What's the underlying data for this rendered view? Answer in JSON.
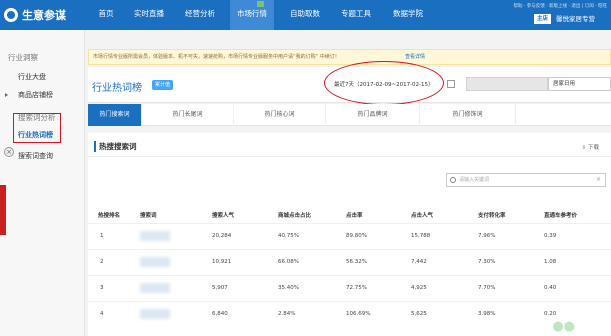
{
  "app": {
    "logo_text": "生意参谋",
    "nav": [
      "首页",
      "实时直播",
      "经营分析",
      "市场行情",
      "自助取数",
      "专题工具",
      "数据学院"
    ],
    "active_nav": "市场行情",
    "top_links": "帮助 · 参与反馈 · 新版上线 · 退出 | 订阅 · 旺旺",
    "shop_tag": "主店",
    "shop_name": "馨悦家居专营"
  },
  "sidebar": {
    "group1": "行业洞察",
    "item_daipan": "行业大盘",
    "item_shop": "商品店铺榜",
    "group2": "搜索词分析",
    "item_hot": "行业热词榜",
    "item_query": "搜索词查询"
  },
  "notice": {
    "text": "市场行情专业版所需会员，体验版本、机不可失，速速抢购，市场行情专业版服务中用户请“我的订购” 中续订！",
    "link": "查看详情"
  },
  "header": {
    "title": "行业热词榜",
    "badge": "累计值",
    "date_range": "最近7天（2017-02-09~2017-02-15）",
    "industry_select": "居家日用"
  },
  "tabs": [
    "热门搜索词",
    "热门长尾词",
    "热门核心词",
    "热门品牌词",
    "热门修饰词"
  ],
  "section": {
    "title": "热搜搜索词",
    "download": "下载",
    "search_placeholder": "请输入关键词",
    "columns": [
      "热搜排名",
      "搜索词",
      "搜索人气",
      "商城点击占比",
      "点击率",
      "点击人气",
      "支付转化率",
      "直通车参考价"
    ],
    "rows": [
      {
        "rank": "1",
        "popularity": "20,284",
        "mall_ratio": "40.75%",
        "ctr": "89.80%",
        "click_pop": "15,788",
        "conv": "7.96%",
        "ztc": "0.39"
      },
      {
        "rank": "2",
        "popularity": "10,921",
        "mall_ratio": "66.08%",
        "ctr": "56.32%",
        "click_pop": "7,442",
        "conv": "7.30%",
        "ztc": "1.08"
      },
      {
        "rank": "3",
        "popularity": "5,907",
        "mall_ratio": "35.40%",
        "ctr": "72.75%",
        "click_pop": "4,925",
        "conv": "7.70%",
        "ztc": "0.40"
      },
      {
        "rank": "4",
        "popularity": "6,840",
        "mall_ratio": "2.84%",
        "ctr": "106.69%",
        "click_pop": "5,625",
        "conv": "3.98%",
        "ztc": "0.20"
      }
    ]
  },
  "colors": {
    "brand": "#1a6fc1",
    "highlight": "#d8141e"
  }
}
